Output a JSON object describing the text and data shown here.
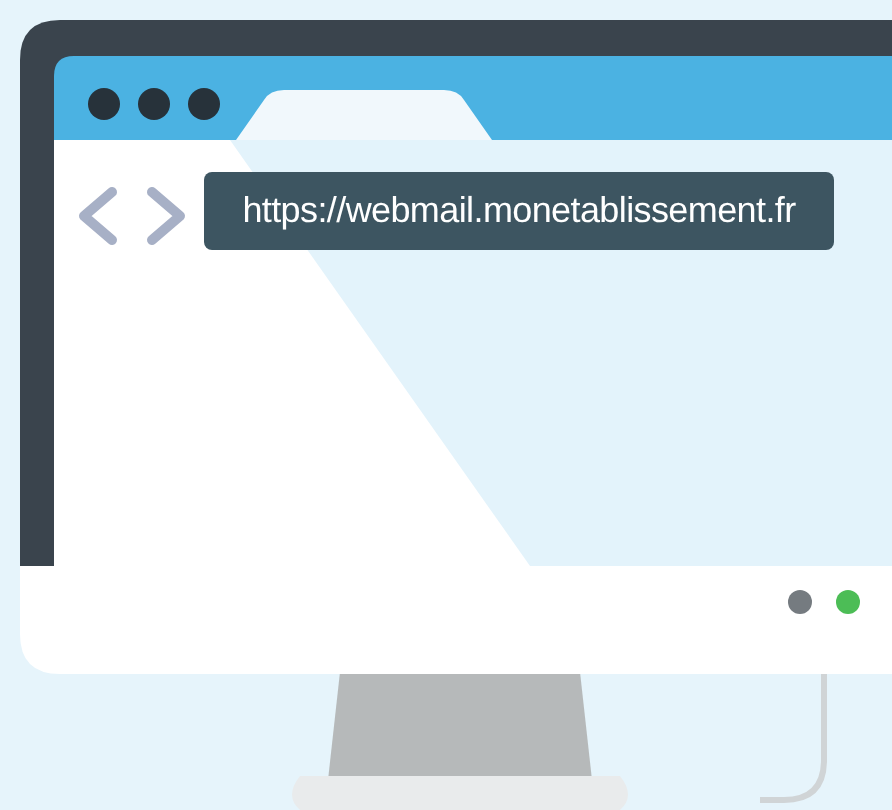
{
  "browser": {
    "url": "https://webmail.monetablissement.fr"
  }
}
